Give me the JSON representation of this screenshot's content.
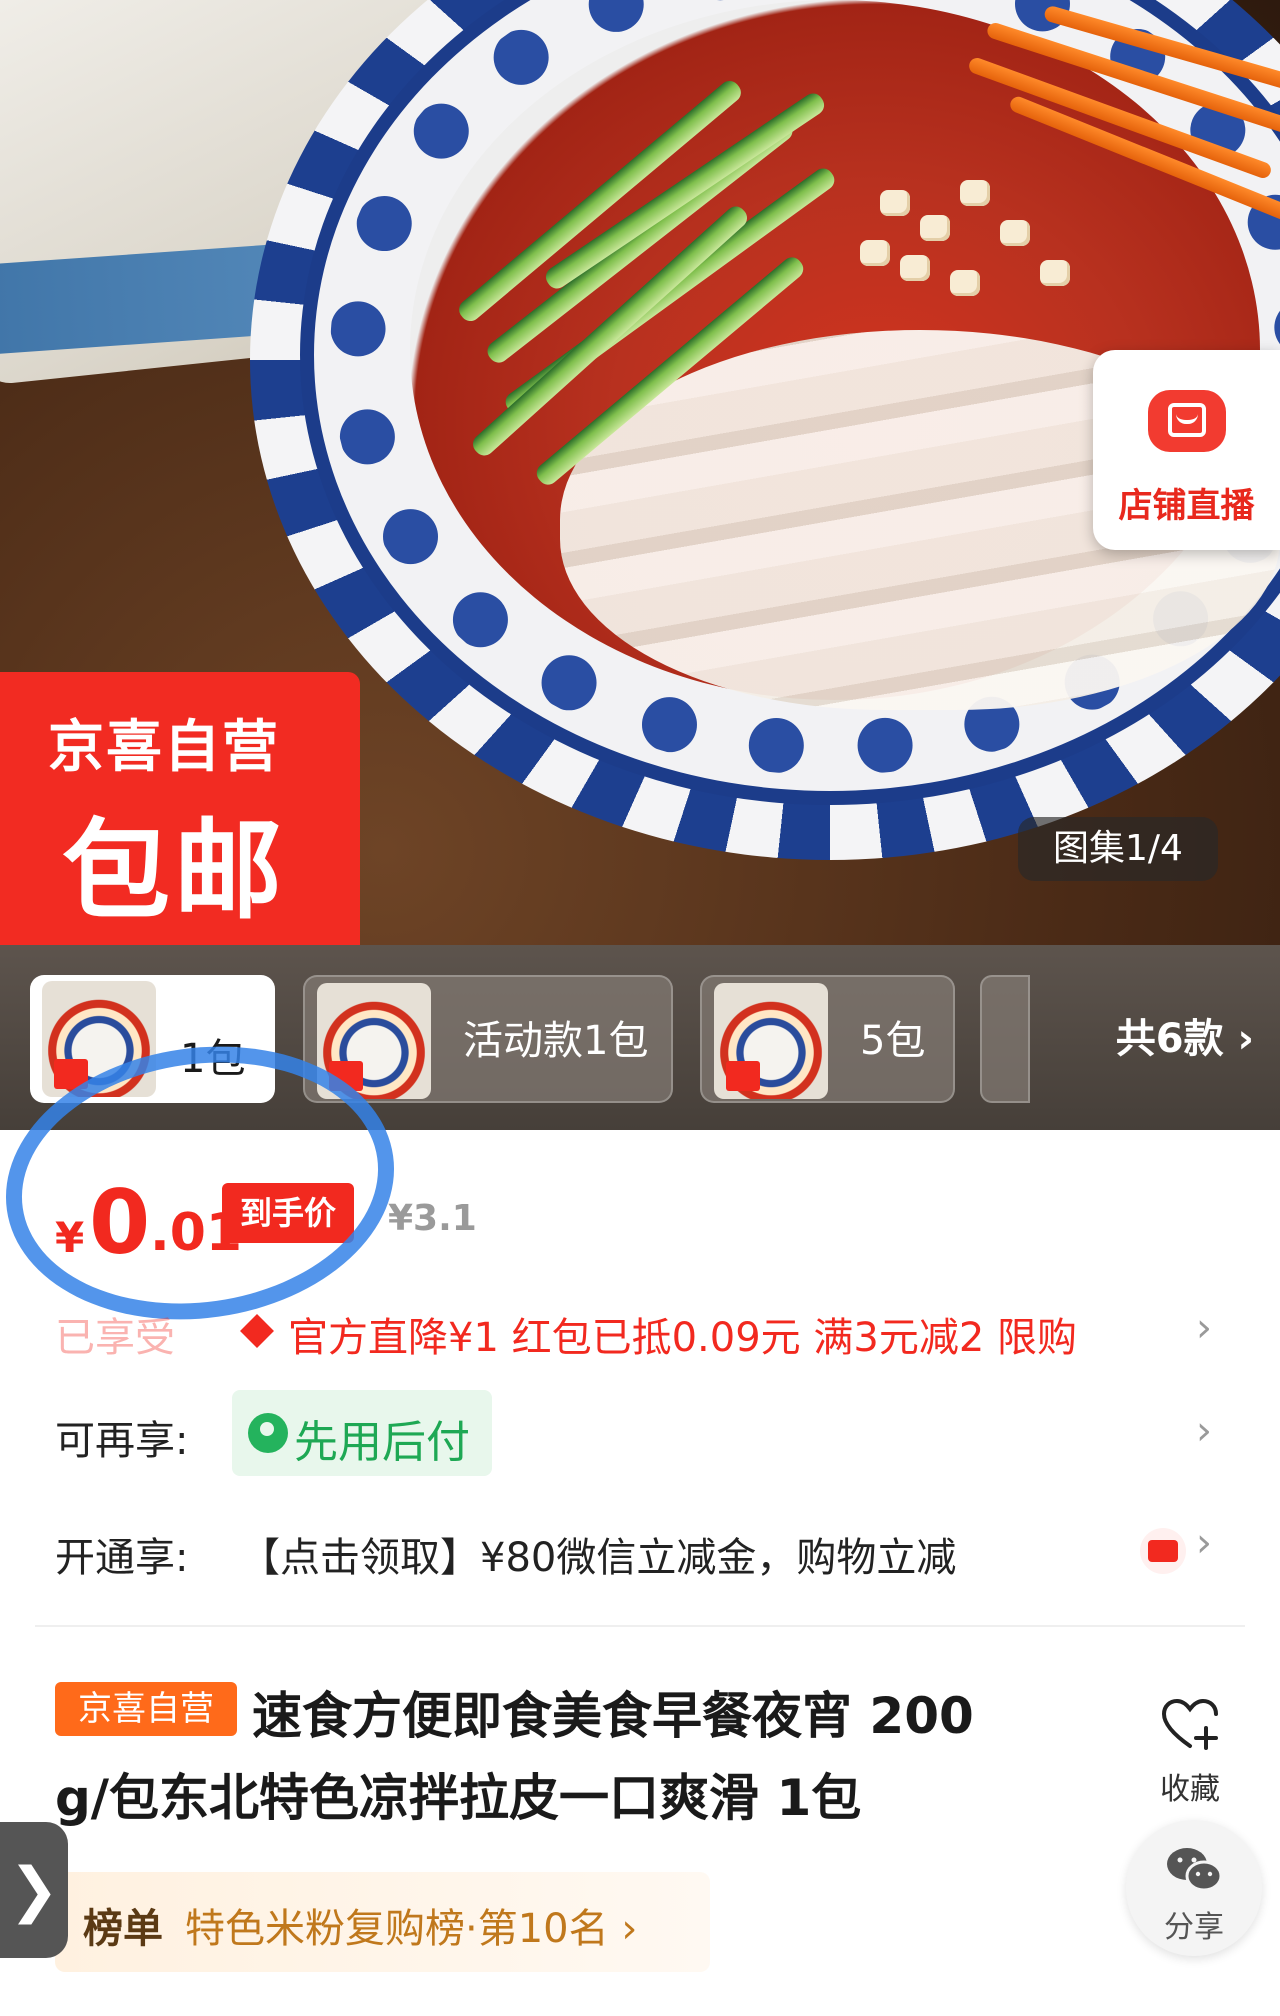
{
  "hero": {
    "ribbon_top": "京喜自营",
    "ribbon_main": "包邮",
    "live_label": "店铺直播",
    "gallery_counter": "图集1/4"
  },
  "sku": {
    "items": [
      {
        "label": "1包",
        "selected": true
      },
      {
        "label": "活动款1包",
        "selected": false
      },
      {
        "label": "5包",
        "selected": false
      }
    ],
    "total": "共6款 ›"
  },
  "price": {
    "currency": "¥",
    "integer": "0",
    "decimal": ".01",
    "tag": "到手价",
    "original": "¥3.1"
  },
  "promotions": {
    "prefix": "已享受",
    "text": "官方直降¥1  红包已抵0.09元  满3元减2  限购"
  },
  "services": {
    "enjoy_label": "可再享:",
    "pay_later": "先用后付",
    "open_label": "开通享:",
    "open_text": "【点击领取】¥80微信立减金，购物立减"
  },
  "product": {
    "self_tag": "京喜自营",
    "title_line1": "速食方便即食美食早餐夜宵 200",
    "title_line2": "g/包东北特色凉拌拉皮一口爽滑 1包",
    "favorite_label": "收藏",
    "share_label": "分享"
  },
  "ranking": {
    "key": "榜单",
    "value": "特色米粉复购榜·第10名 ›"
  },
  "side_handle": "❯",
  "colors": {
    "accent_red": "#f2291f",
    "pay_green": "#1ea854",
    "self_tag_orange": "#ff6a1a"
  }
}
